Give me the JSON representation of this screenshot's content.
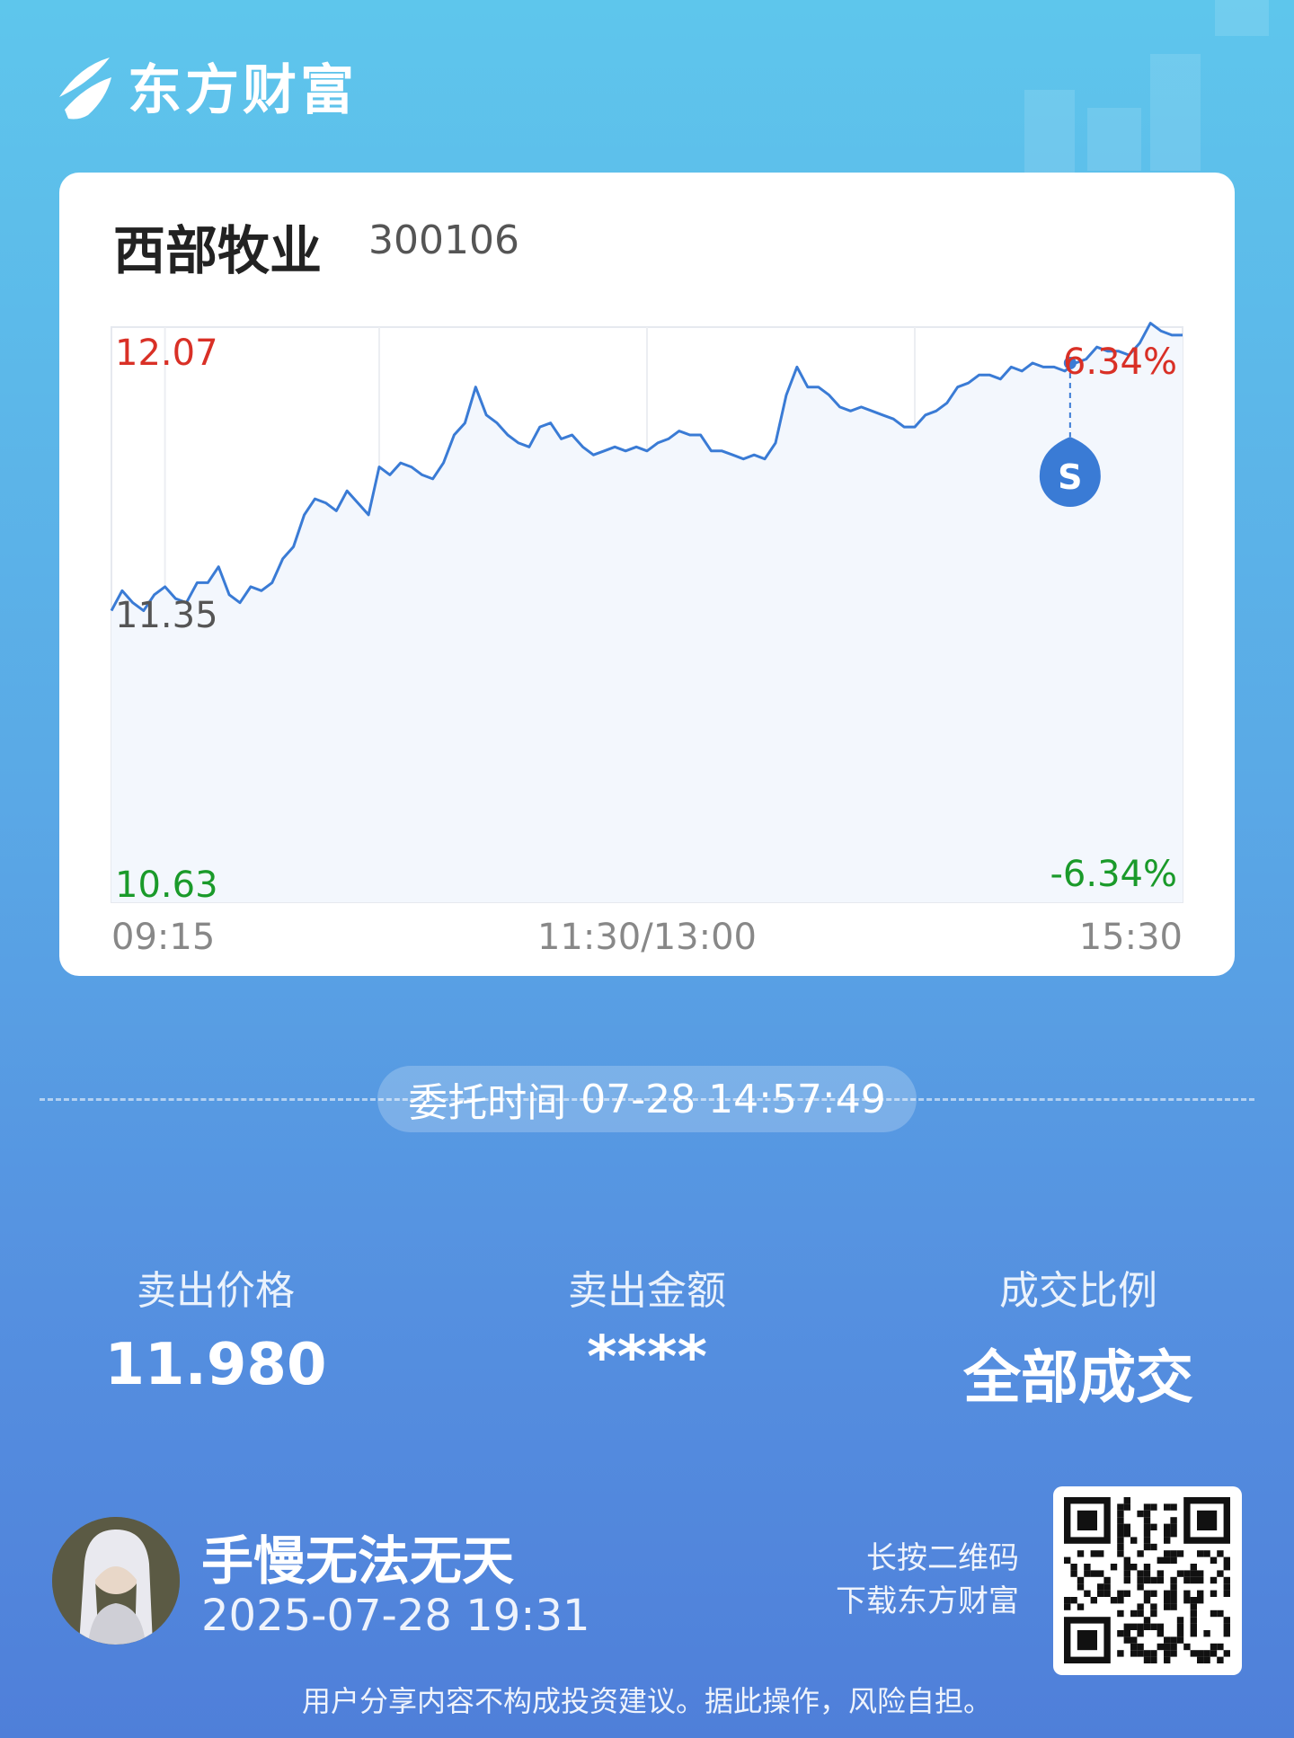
{
  "brand": {
    "name": "东方财富"
  },
  "stock": {
    "name": "西部牧业",
    "code": "300106"
  },
  "chart_data": {
    "type": "line",
    "title": "",
    "x_ticks": [
      "09:15",
      "11:30/13:00",
      "15:30"
    ],
    "y_ticks": {
      "top": "12.07",
      "middle": "11.35",
      "bottom": "10.63"
    },
    "pct_ticks": {
      "top": "6.34%",
      "bottom": "-6.34%"
    },
    "ylim": [
      10.63,
      12.07
    ],
    "prev_close": 11.35,
    "marker": {
      "label": "S",
      "time_index": 0.895,
      "price": 11.98
    },
    "series": [
      {
        "values": [
          11.36,
          11.41,
          11.38,
          11.36,
          11.4,
          11.42,
          11.39,
          11.38,
          11.43,
          11.43,
          11.47,
          11.4,
          11.38,
          11.42,
          11.41,
          11.43,
          11.49,
          11.52,
          11.6,
          11.64,
          11.63,
          11.61,
          11.66,
          11.63,
          11.6,
          11.72,
          11.7,
          11.73,
          11.72,
          11.7,
          11.69,
          11.73,
          11.8,
          11.83,
          11.92,
          11.85,
          11.83,
          11.8,
          11.78,
          11.77,
          11.82,
          11.83,
          11.79,
          11.8,
          11.77,
          11.75,
          11.76,
          11.77,
          11.76,
          11.77,
          11.76,
          11.78,
          11.79,
          11.81,
          11.8,
          11.8,
          11.76,
          11.76,
          11.75,
          11.74,
          11.75,
          11.74,
          11.78,
          11.9,
          11.97,
          11.92,
          11.92,
          11.9,
          11.87,
          11.86,
          11.87,
          11.86,
          11.85,
          11.84,
          11.82,
          11.82,
          11.85,
          11.86,
          11.88,
          11.92,
          11.93,
          11.95,
          11.95,
          11.94,
          11.97,
          11.96,
          11.98,
          11.97,
          11.97,
          11.96,
          11.98,
          11.99,
          12.02,
          12.01,
          12.01,
          12.0,
          12.03,
          12.08,
          12.06,
          12.05,
          12.05
        ]
      }
    ]
  },
  "order": {
    "label": "委托时间",
    "time": "07-28 14:57:49"
  },
  "stats": [
    {
      "label": "卖出价格",
      "value": "11.980"
    },
    {
      "label": "卖出金额",
      "value": "****"
    },
    {
      "label": "成交比例",
      "value": "全部成交"
    }
  ],
  "user": {
    "name": "手慢无法无天",
    "datetime": "2025-07-28 19:31"
  },
  "qr_hint": {
    "line1": "长按二维码",
    "line2": "下载东方财富"
  },
  "disclaimer": "用户分享内容不构成投资建议。据此操作，风险自担。",
  "colors": {
    "line": "#3a7bd5",
    "up": "#d93026",
    "down": "#1a9a2a",
    "marker": "#3a7bd5"
  }
}
